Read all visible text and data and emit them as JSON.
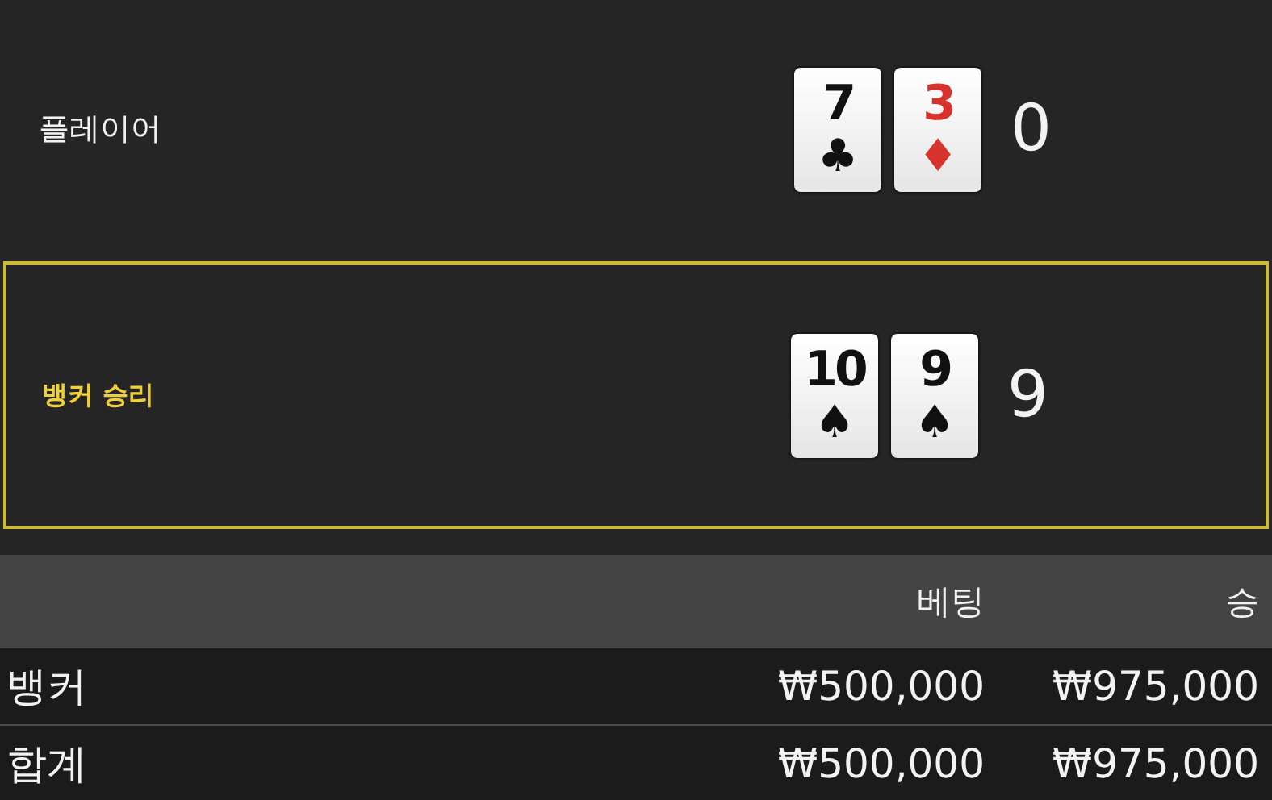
{
  "hands": [
    {
      "label": "플레이어",
      "winner": false,
      "score": "0",
      "cards": [
        {
          "rank": "7",
          "suit": "♣",
          "color": "#111111"
        },
        {
          "rank": "3",
          "suit": "♦",
          "color": "#d8322c"
        }
      ]
    },
    {
      "label": "뱅커 승리",
      "winner": true,
      "score": "9",
      "cards": [
        {
          "rank": "10",
          "suit": "♠",
          "color": "#111111"
        },
        {
          "rank": "9",
          "suit": "♠",
          "color": "#111111"
        }
      ]
    }
  ],
  "table": {
    "columns": [
      "베팅",
      "승"
    ],
    "rows": [
      {
        "label": "뱅커",
        "bet": "₩500,000",
        "win": "₩975,000"
      },
      {
        "label": "합계",
        "bet": "₩500,000",
        "win": "₩975,000"
      }
    ]
  }
}
